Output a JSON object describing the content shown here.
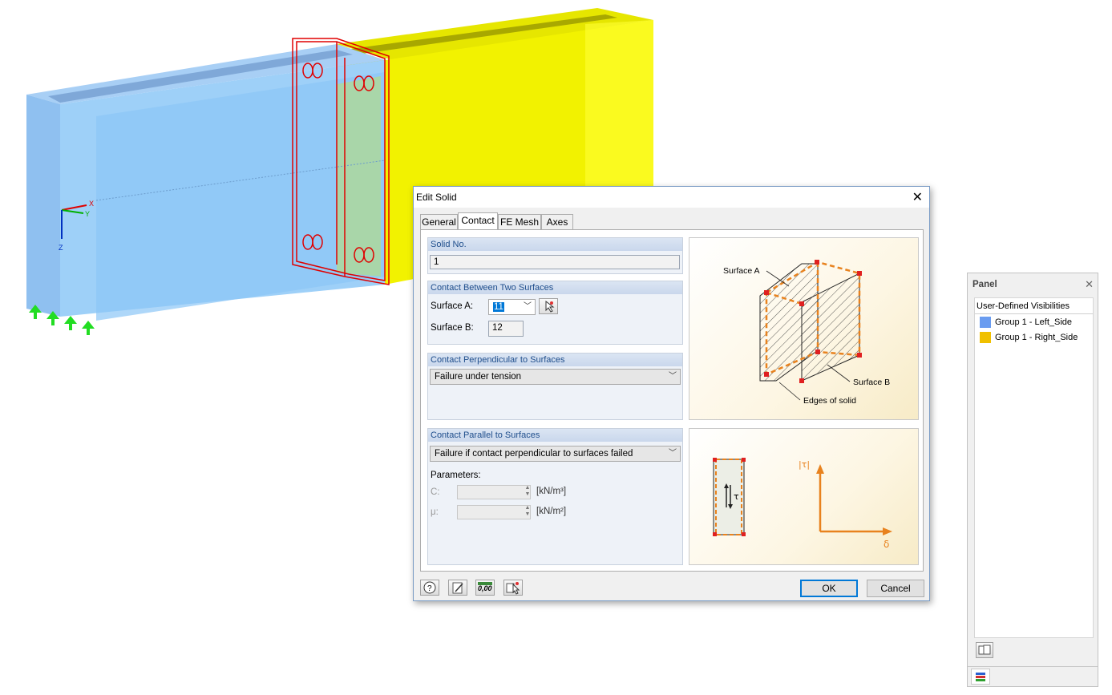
{
  "viewport": {
    "axes": {
      "x": "X",
      "y": "Y",
      "z": "Z"
    }
  },
  "dialog": {
    "title": "Edit Solid",
    "tabs": [
      {
        "label": "General"
      },
      {
        "label": "Contact"
      },
      {
        "label": "FE Mesh"
      },
      {
        "label": "Axes"
      }
    ],
    "active_tab": "Contact",
    "solid_no": {
      "heading": "Solid No.",
      "value": "1"
    },
    "contact_surfaces": {
      "heading": "Contact Between Two Surfaces",
      "surface_a_label": "Surface A:",
      "surface_a_value": "11",
      "surface_b_label": "Surface B:",
      "surface_b_value": "12"
    },
    "perpendicular": {
      "heading": "Contact Perpendicular to Surfaces",
      "value": "Failure under tension"
    },
    "parallel": {
      "heading": "Contact Parallel to Surfaces",
      "value": "Failure if contact perpendicular to surfaces failed",
      "parameters_label": "Parameters:",
      "c_label": "C:",
      "c_unit": "[kN/m³]",
      "mu_label": "μ:",
      "mu_unit": "[kN/m²]"
    },
    "illustration": {
      "surface_a": "Surface A",
      "surface_b": "Surface B",
      "edges": "Edges of solid",
      "tau": "τ",
      "tau_abs": "|τ|",
      "delta": "δ"
    },
    "buttons": {
      "ok": "OK",
      "cancel": "Cancel"
    },
    "icons": {
      "numeric": "0,00"
    }
  },
  "panel": {
    "title": "Panel",
    "section_title": "User-Defined Visibilities",
    "items": [
      {
        "label": "Group 1 - Left_Side",
        "color": "#6a9cf0"
      },
      {
        "label": "Group 1 - Right_Side",
        "color": "#f0c000"
      }
    ]
  }
}
